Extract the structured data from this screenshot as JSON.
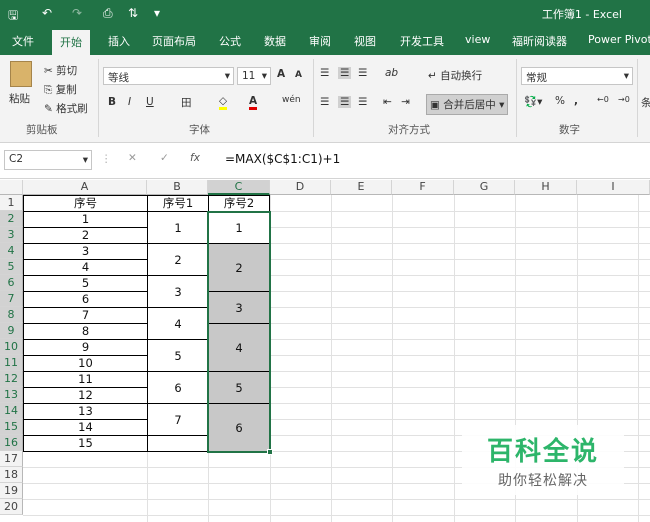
{
  "window": {
    "title": "工作簿1 - Excel"
  },
  "quick_access": [
    {
      "name": "save-icon",
      "glyph": "🖫"
    },
    {
      "name": "undo-icon",
      "glyph": "↶"
    },
    {
      "name": "redo-icon",
      "glyph": "↷"
    },
    {
      "name": "print-preview-icon",
      "glyph": "⎙"
    },
    {
      "name": "sort-icon",
      "glyph": "⇅"
    },
    {
      "name": "customize-icon",
      "glyph": "▾"
    }
  ],
  "tabs": [
    "文件",
    "开始",
    "插入",
    "页面布局",
    "公式",
    "数据",
    "审阅",
    "视图",
    "开发工具",
    "view",
    "福昕阅读器",
    "Power Pivot"
  ],
  "active_tab": "开始",
  "ribbon": {
    "clipboard": {
      "paste": "粘贴",
      "cut": "剪切",
      "copy": "复制",
      "format_painter": "格式刷",
      "group": "剪贴板"
    },
    "font": {
      "name": "等线",
      "size": "11",
      "grow": "A",
      "shrink": "A",
      "bold": "B",
      "italic": "I",
      "underline": "U",
      "borders": "田",
      "fill": "◇",
      "color": "A",
      "phonetic": "wén",
      "group": "字体"
    },
    "alignment": {
      "orientation": "ab",
      "wrap": "自动换行",
      "merge": "合并后居中",
      "group": "对齐方式"
    },
    "number": {
      "format": "常规",
      "percent": "%",
      "comma": ",",
      "group": "数字"
    },
    "styles_partial": "条"
  },
  "formula_bar": {
    "name_box": "C2",
    "cancel": "✕",
    "enter": "✓",
    "fx": "fx",
    "formula": "=MAX($C$1:C1)+1"
  },
  "sheet": {
    "columns": [
      "A",
      "B",
      "C",
      "D",
      "E",
      "F",
      "G",
      "H",
      "I"
    ],
    "rows": [
      "1",
      "2",
      "3",
      "4",
      "5",
      "6",
      "7",
      "8",
      "9",
      "10",
      "11",
      "12",
      "13",
      "14",
      "15",
      "16",
      "17",
      "18",
      "19",
      "20"
    ],
    "selected_column": "C",
    "headers": {
      "A": "序号",
      "B": "序号1",
      "C": "序号2"
    },
    "col_a": [
      "1",
      "2",
      "3",
      "4",
      "5",
      "6",
      "7",
      "8",
      "9",
      "10",
      "11",
      "12",
      "13",
      "14",
      "15"
    ],
    "col_b": [
      "1",
      "2",
      "3",
      "4",
      "5",
      "6",
      "7"
    ],
    "col_c": [
      "1",
      "2",
      "3",
      "4",
      "5",
      "6"
    ]
  },
  "watermark": {
    "brand": "百科全说",
    "tagline": "助你轻松解决"
  }
}
